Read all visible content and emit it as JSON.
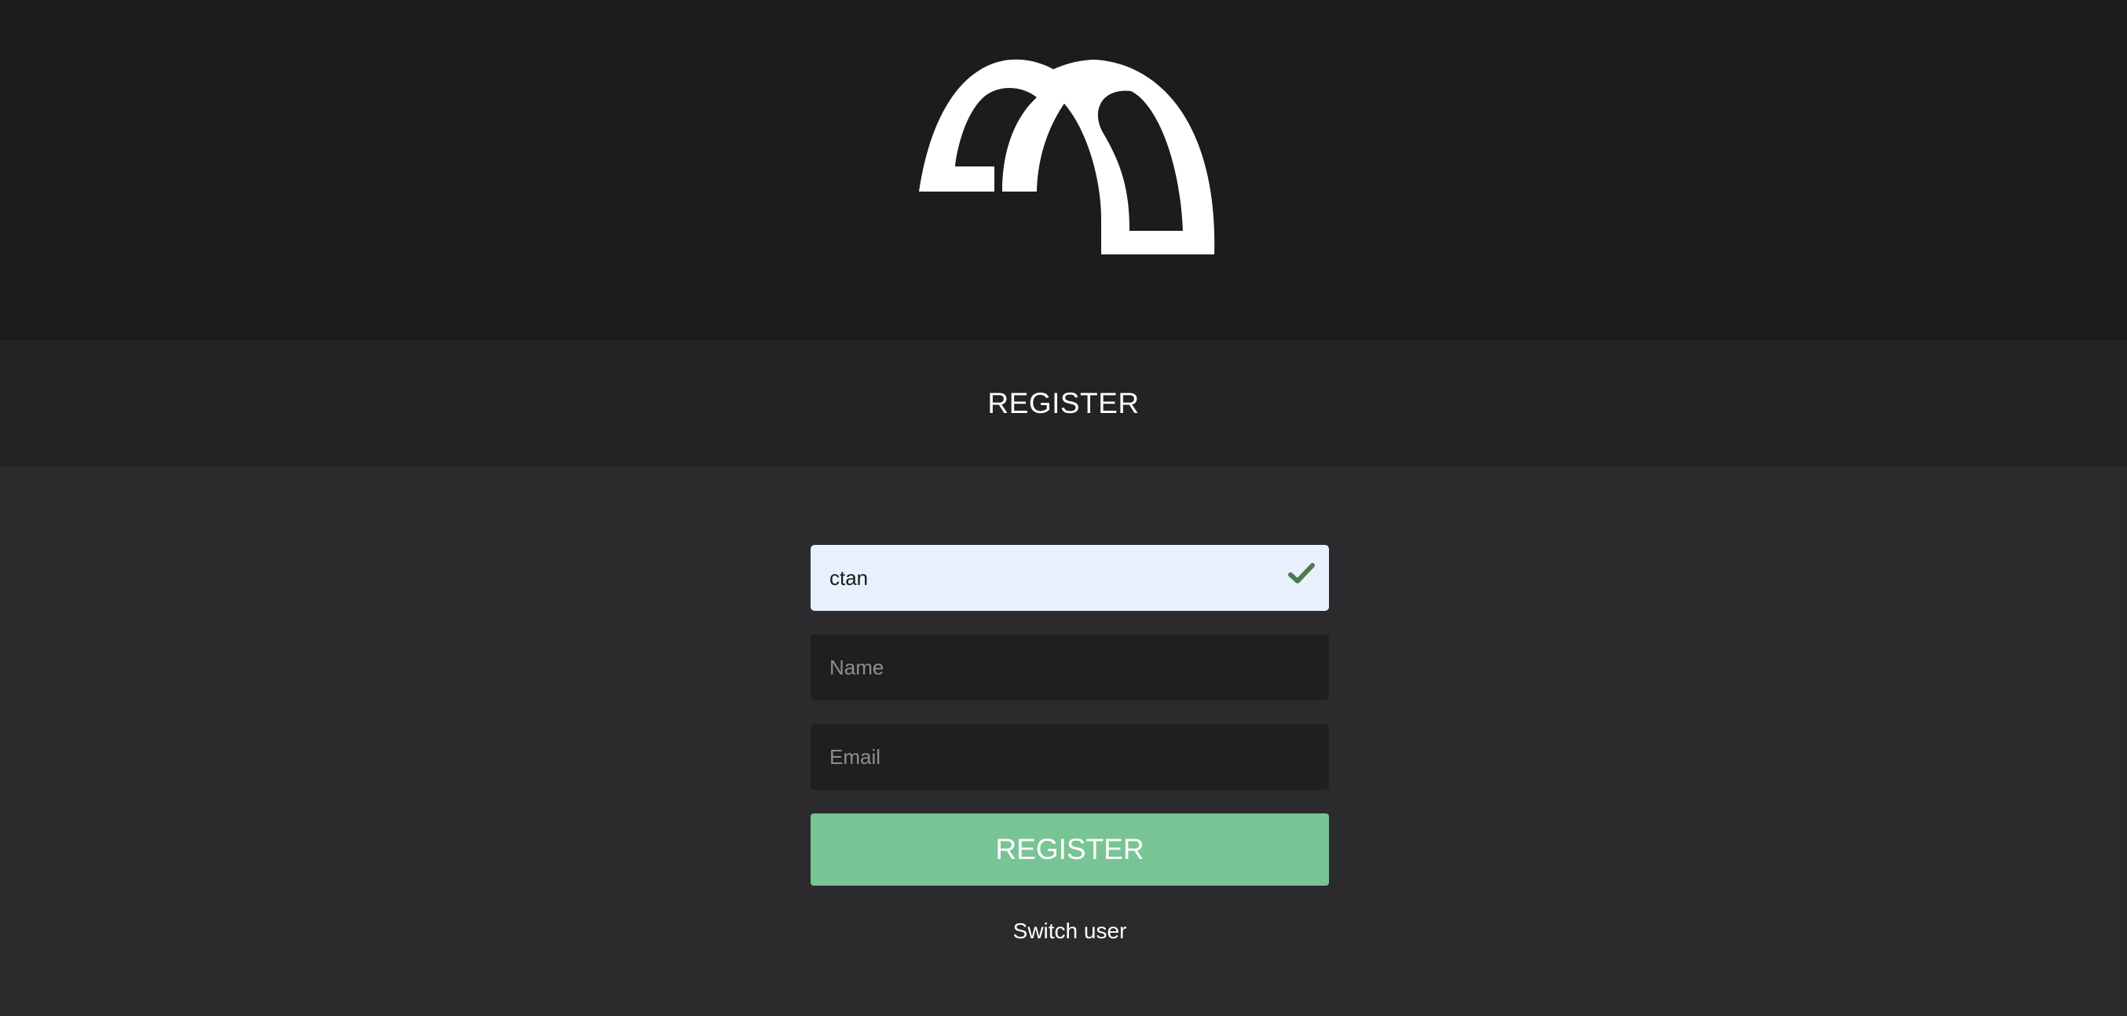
{
  "header": {
    "logo_icon": "arch-m-logo-icon"
  },
  "title_band": {
    "title": "REGISTER"
  },
  "form": {
    "username": {
      "value": "ctan",
      "valid_icon": "checkmark-icon",
      "valid_color": "#4c7a4c"
    },
    "name": {
      "value": "",
      "placeholder": "Name"
    },
    "email": {
      "value": "",
      "placeholder": "Email"
    },
    "submit_label": "REGISTER",
    "submit_color": "#78c495",
    "switch_user_label": "Switch user"
  }
}
